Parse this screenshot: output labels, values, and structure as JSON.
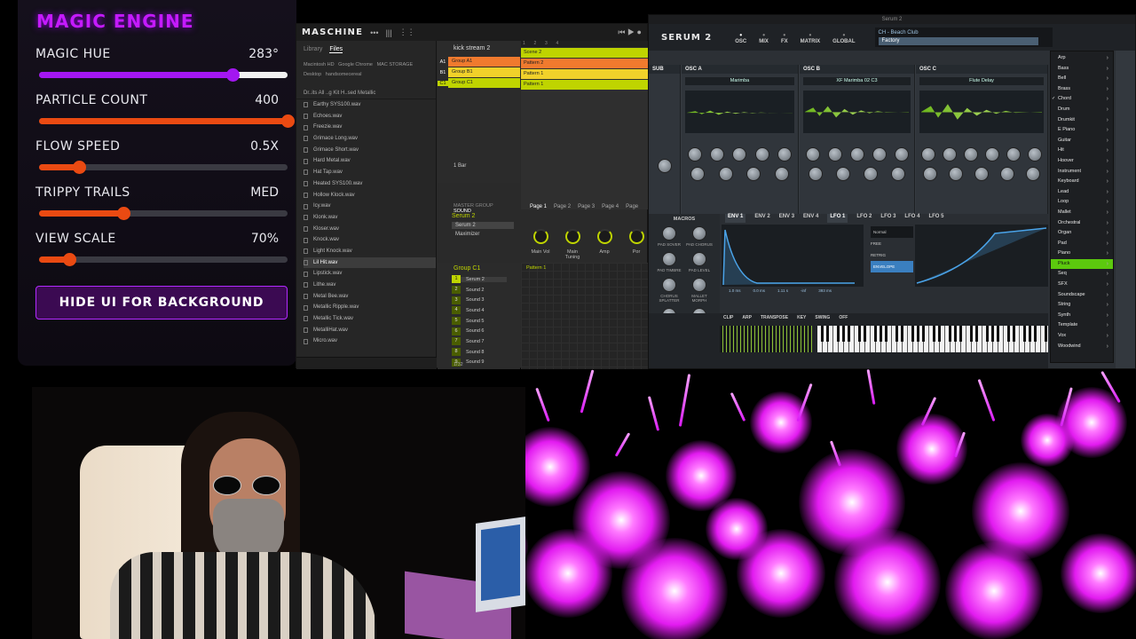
{
  "magic_engine": {
    "title": "MAGIC ENGINE",
    "params": [
      {
        "label": "MAGIC HUE",
        "value": "283°",
        "level": 0.78
      },
      {
        "label": "PARTICLE COUNT",
        "value": "400",
        "level": 1.0
      },
      {
        "label": "FLOW SPEED",
        "value": "0.5X",
        "level": 0.16
      },
      {
        "label": "TRIPPY TRAILS",
        "value": "MED",
        "level": 0.34
      },
      {
        "label": "VIEW SCALE",
        "value": "70%",
        "level": 0.12
      }
    ],
    "hide_button": "HIDE UI FOR BACKGROUND"
  },
  "maschine": {
    "logo": "MASCHINE",
    "browser_tabs": [
      "Library",
      "Files"
    ],
    "sources": [
      "Macintosh HD",
      "Google Chrome",
      "MAC STORAGE",
      "Desktop",
      "handsomecereal"
    ],
    "path": "Dr..its  All ..g Kit  H..sed  Metallic",
    "files": [
      "Earthy SYS100.wav",
      "Echoes.wav",
      "Freezie.wav",
      "Grimace Long.wav",
      "Grimace Short.wav",
      "Hard Metal.wav",
      "Hat Tap.wav",
      "Heated SYS100.wav",
      "Hollow Klock.wav",
      "Icy.wav",
      "Klonk.wav",
      "Kloser.wav",
      "Knock.wav",
      "Light Knock.wav",
      "Lil Hit.wav",
      "Lipstick.wav",
      "Lithe.wav",
      "Metal Bee.wav",
      "Metallic Ripple.wav",
      "Metallic Tick.wav",
      "MetalliHat.wav",
      "Micro.wav"
    ],
    "selected_file": "Lil Hit.wav",
    "project": "kick stream 2",
    "groups": [
      {
        "letter": "A1",
        "name": "Group A1",
        "color": "#f07a2e"
      },
      {
        "letter": "B1",
        "name": "Group B1",
        "color": "#f1d12a"
      },
      {
        "letter": "C1",
        "name": "Group C1",
        "color": "#bfd400"
      }
    ],
    "scene": "Scene 2",
    "patterns": [
      "Pattern 2",
      "Pattern 1",
      "Pattern 1"
    ],
    "bar_label": "1 Bar",
    "sound_tabs": [
      "MASTER",
      "GROUP",
      "SOUND"
    ],
    "plugin_slot": "Serum 2",
    "plugins": [
      "Serum 2",
      "Maximizer"
    ],
    "pages": [
      "Page 1",
      "Page 2",
      "Page 3",
      "Page 4",
      "Page"
    ],
    "knobs": [
      "Main Vol",
      "Main Tuning",
      "Amp",
      "Por"
    ],
    "group_c1": "Group C1",
    "pattern_c1": "Pattern 1",
    "sounds": [
      "Serum 2",
      "Sound 2",
      "Sound 3",
      "Sound 4",
      "Sound 5",
      "Sound 6",
      "Sound 7",
      "Sound 8",
      "Sound 9"
    ],
    "page_count": "1/32"
  },
  "serum": {
    "window_title": "Serum 2",
    "logo": "SERUM 2",
    "tabs": [
      "OSC",
      "MIX",
      "FX",
      "MATRIX",
      "GLOBAL"
    ],
    "preset_name": "CH - Beach Club",
    "preset_bank": "Factory",
    "oscillators": [
      {
        "head": "SUB",
        "name": ""
      },
      {
        "head": "OSC A",
        "name": "Marimba"
      },
      {
        "head": "OSC B",
        "name": "XF Marimba 02 C3"
      },
      {
        "head": "OSC C",
        "name": "Flute Delay"
      }
    ],
    "mod_tabs": [
      "MACROS",
      "ENV 1",
      "ENV 2",
      "ENV 3",
      "ENV 4",
      "LFO 1",
      "LFO 2",
      "LFO 3",
      "LFO 4",
      "LFO 5"
    ],
    "macros": [
      "PAD SOVER",
      "PAD CHORUS",
      "PAD TIMBRE",
      "PAD LEVEL",
      "CHORUS SPLATTER",
      "MALLET MORPH",
      "SLAP VERB",
      "FILTER A/B MIX"
    ],
    "env_values": [
      "1.0 ms",
      "0.0 ms",
      "1.11 s",
      "-inf",
      "393 ms"
    ],
    "lfo_side": [
      "Normal",
      "FREE",
      "RETRIG",
      "ENVELOPE"
    ],
    "bottom_tabs": [
      "CLIP",
      "ARP",
      "TRANSPOSE",
      "KEY",
      "SWING",
      "OFF"
    ],
    "categories": [
      "Arp",
      "Bass",
      "Bell",
      "Brass",
      "Chord",
      "Drum",
      "Drumkit",
      "E Piano",
      "Guitar",
      "Hit",
      "Hoover",
      "Instrument",
      "Keyboard",
      "Lead",
      "Loop",
      "Mallet",
      "Orchestral",
      "Organ",
      "Pad",
      "Piano",
      "Pluck",
      "Seq",
      "SFX",
      "Soundscape",
      "String",
      "Synth",
      "Template",
      "Vox",
      "Woodwind"
    ],
    "checked_category": "Chord",
    "selected_category": "Pluck"
  },
  "colors": {
    "accent_purple": "#c51aff",
    "accent_orange": "#ea4a12",
    "maschine_green": "#bfd400",
    "serum_green": "#5cc90e"
  }
}
